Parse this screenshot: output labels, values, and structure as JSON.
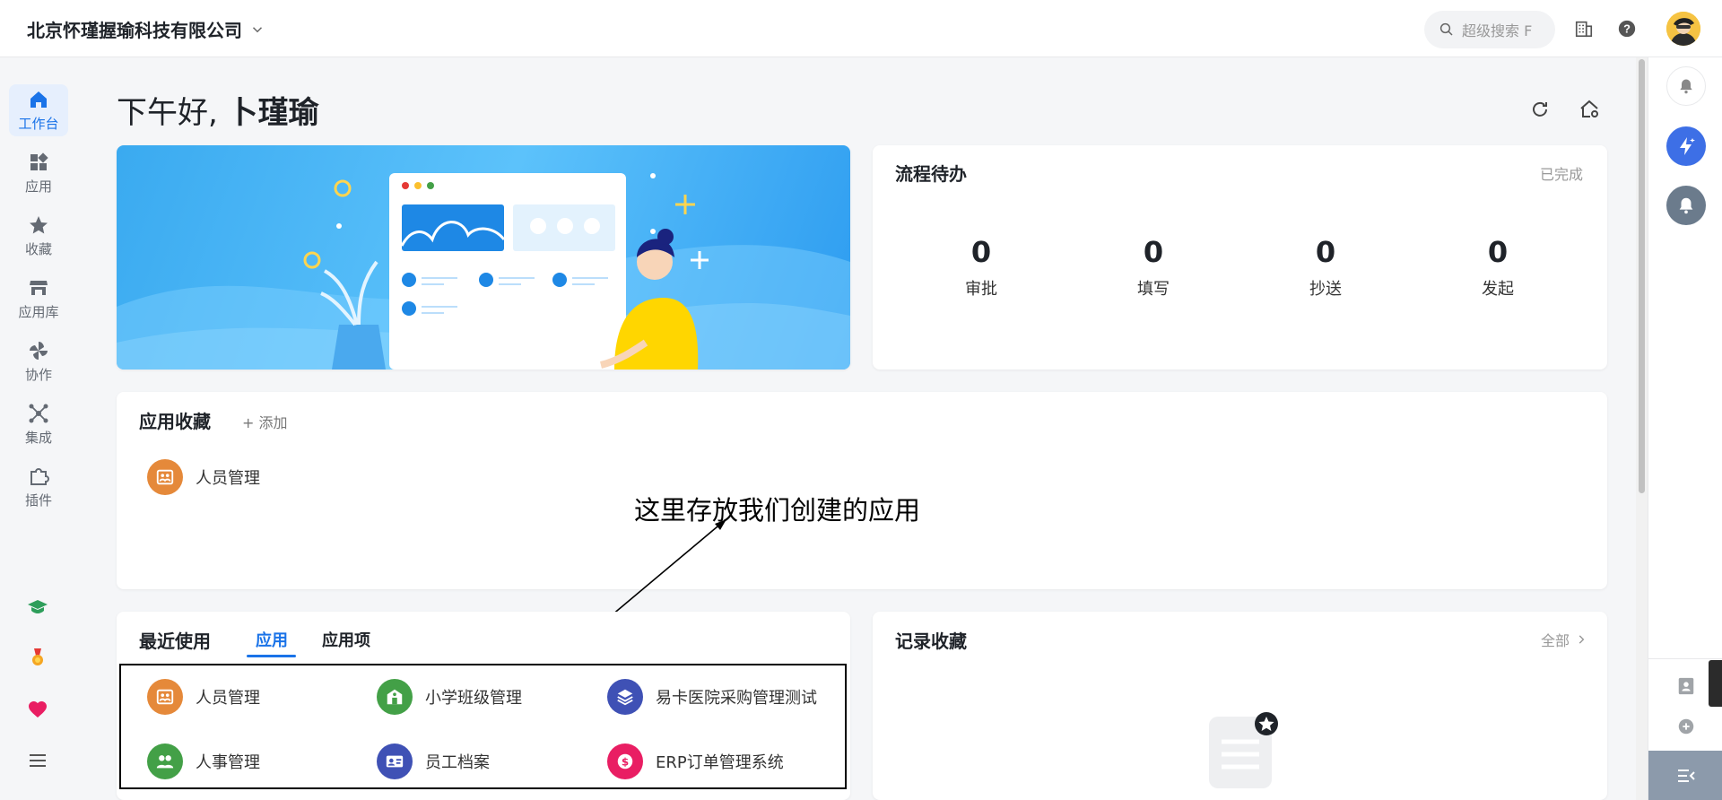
{
  "header": {
    "company": "北京怀瑾握瑜科技有限公司",
    "search_placeholder": "超级搜索  F"
  },
  "nav": {
    "items": [
      {
        "label": "工作台",
        "icon": "home-icon",
        "active": true
      },
      {
        "label": "应用",
        "icon": "apps-icon"
      },
      {
        "label": "收藏",
        "icon": "star-icon"
      },
      {
        "label": "应用库",
        "icon": "store-icon"
      },
      {
        "label": "协作",
        "icon": "pinwheel-icon"
      },
      {
        "label": "集成",
        "icon": "network-icon"
      },
      {
        "label": "插件",
        "icon": "plugin-icon"
      }
    ],
    "bottom": [
      "graduation-cap-icon",
      "medal-icon",
      "heart-icon",
      "menu-icon"
    ]
  },
  "greeting": {
    "prefix": "下午好,",
    "name": "卜瑾瑜"
  },
  "workflow": {
    "title": "流程待办",
    "done_link": "已完成",
    "stats": [
      {
        "value": "0",
        "label": "审批"
      },
      {
        "value": "0",
        "label": "填写"
      },
      {
        "value": "0",
        "label": "抄送"
      },
      {
        "value": "0",
        "label": "发起"
      }
    ]
  },
  "favorites": {
    "title": "应用收藏",
    "add_label": "+ 添加",
    "apps": [
      {
        "name": "人员管理",
        "color": "#e5893a"
      }
    ]
  },
  "annotation": {
    "text": "这里存放我们创建的应用"
  },
  "recent": {
    "title": "最近使用",
    "tabs": [
      "应用",
      "应用项"
    ],
    "apps": [
      {
        "name": "人员管理",
        "color": "#e5893a"
      },
      {
        "name": "小学班级管理",
        "color": "#43a047"
      },
      {
        "name": "易卡医院采购管理测试",
        "color": "#3f51b5"
      },
      {
        "name": "人事管理",
        "color": "#43a047"
      },
      {
        "name": "员工档案",
        "color": "#3f51b5"
      },
      {
        "name": "ERP订单管理系统",
        "color": "#e91e63"
      }
    ]
  },
  "records": {
    "title": "记录收藏",
    "all_link": "全部"
  },
  "colors": {
    "accent": "#1a73e8"
  }
}
